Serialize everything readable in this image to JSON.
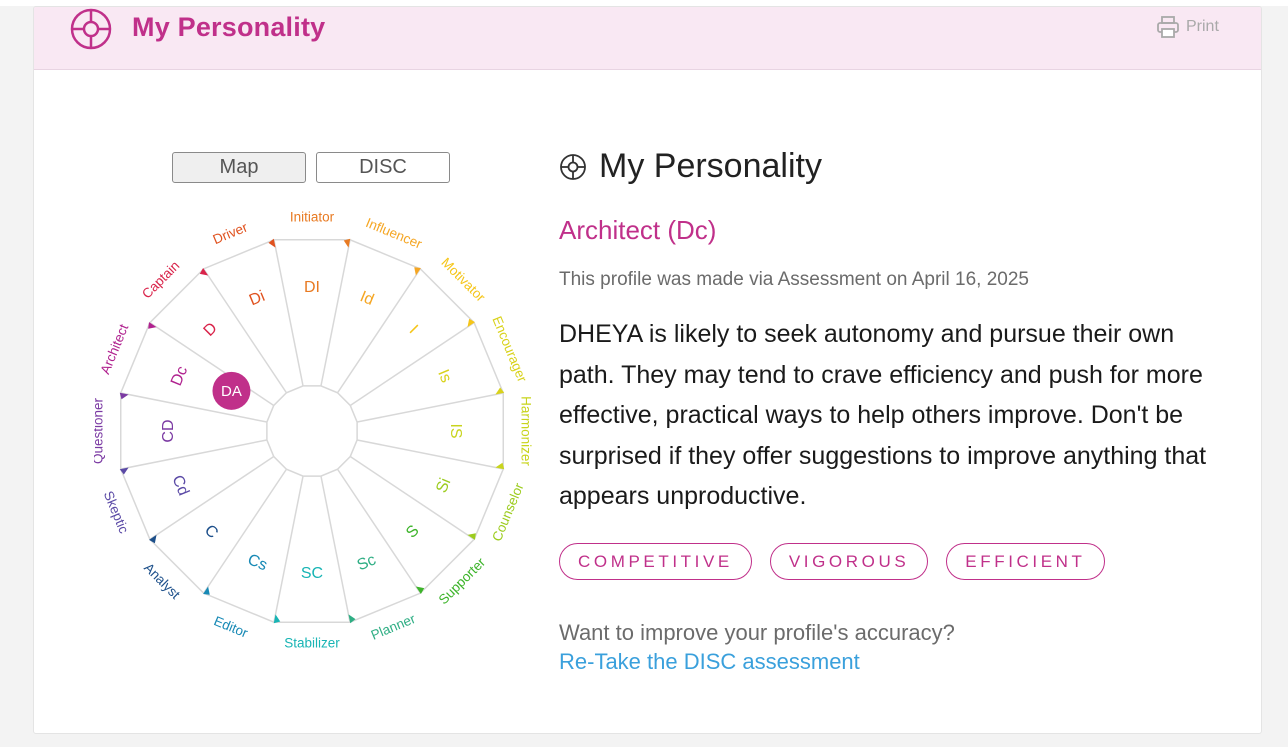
{
  "header": {
    "title": "My Personality",
    "print_label": "Print",
    "icon": "crosshair-compass-icon"
  },
  "toggles": {
    "map_label": "Map",
    "disc_label": "DISC",
    "active": "Map"
  },
  "wheel": {
    "outer_labels": [
      "Initiator",
      "Influencer",
      "Motivator",
      "Encourager",
      "Harmonizer",
      "Counselor",
      "Supporter",
      "Planner",
      "Stabilizer",
      "Editor",
      "Analyst",
      "Skeptic",
      "Questioner",
      "Architect",
      "Captain",
      "Driver"
    ],
    "inner_labels": [
      "DI",
      "Id",
      "I",
      "Is",
      "IS",
      "Si",
      "S",
      "Sc",
      "SC",
      "Cs",
      "C",
      "Cd",
      "CD",
      "Dc",
      "D",
      "Di"
    ],
    "colors": [
      "#e87a22",
      "#f5a623",
      "#f5c518",
      "#d9d21a",
      "#c8d41d",
      "#9ccc1e",
      "#3db42a",
      "#2fae84",
      "#17b4b4",
      "#1789b5",
      "#1c4f8a",
      "#5b4aa6",
      "#7b3aa3",
      "#b0228f",
      "#d9234a",
      "#e0521f"
    ],
    "marker": "DA",
    "marker_color": "#c0308a"
  },
  "profile": {
    "title": "My Personality",
    "type": "Architect (Dc)",
    "made_via": "This profile was made via Assessment on April 16, 2025",
    "description": "DHEYA is likely to seek autonomy and pursue their own path. They may tend to crave efficiency and push for more effective, practical ways to help others improve. Don't be surprised if they offer suggestions to improve anything that appears unproductive.",
    "traits": [
      "COMPETITIVE",
      "VIGOROUS",
      "EFFICIENT"
    ],
    "improve_question": "Want to improve your profile's accuracy?",
    "retake_link": "Re-Take the DISC assessment"
  }
}
